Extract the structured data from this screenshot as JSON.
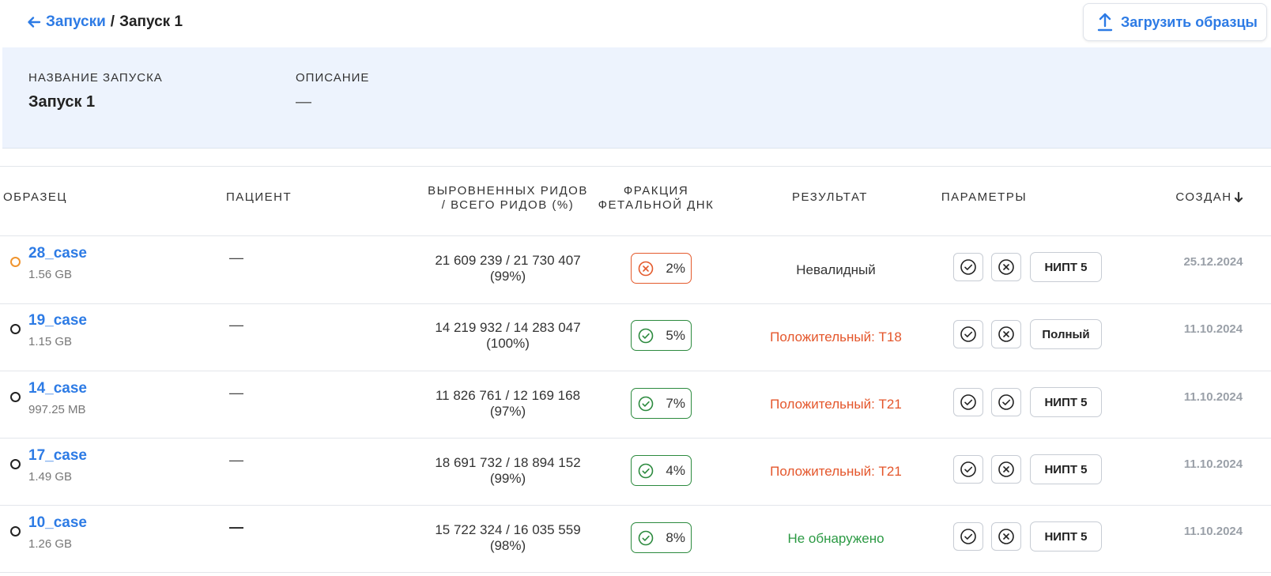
{
  "breadcrumb": {
    "parent": "Запуски",
    "separator": "/",
    "current": "Запуск 1"
  },
  "upload_button": "Загрузить образцы",
  "run_info": {
    "name_label": "НАЗВАНИЕ ЗАПУСКА",
    "name_value": "Запуск 1",
    "description_label": "ОПИСАНИЕ",
    "description_value": "—"
  },
  "table": {
    "headers": {
      "sample": "ОБРАЗЕЦ",
      "patient": "ПАЦИЕНТ",
      "reads_line1": "ВЫРОВНЕННЫХ РИДОВ",
      "reads_line2": "/ ВСЕГО РИДОВ (%)",
      "fraction_line1": "ФРАКЦИЯ",
      "fraction_line2": "ФЕТАЛЬНОЙ ДНК",
      "result": "РЕЗУЛЬТАТ",
      "params": "ПАРАМЕТРЫ",
      "created": "СОЗДАН"
    },
    "rows": [
      {
        "name": "28_case",
        "size": "1.56 GB",
        "patient": "—",
        "reads_line1": "21 609 239 / 21 730 407",
        "reads_line2": "(99%)",
        "fraction": "2%",
        "result": "Невалидный",
        "mode": "НИПТ 5",
        "created": "25.12.2024"
      },
      {
        "name": "19_case",
        "size": "1.15 GB",
        "patient": "—",
        "reads_line1": "14 219 932 / 14 283 047",
        "reads_line2": "(100%)",
        "fraction": "5%",
        "result": "Положительный: T18",
        "mode": "Полный",
        "created": "11.10.2024"
      },
      {
        "name": "14_case",
        "size": "997.25 MB",
        "patient": "—",
        "reads_line1": "11 826 761 / 12 169 168",
        "reads_line2": "(97%)",
        "fraction": "7%",
        "result": "Положительный: T21",
        "mode": "НИПТ 5",
        "created": "11.10.2024"
      },
      {
        "name": "17_case",
        "size": "1.49 GB",
        "patient": "—",
        "reads_line1": "18 691 732 / 18 894 152",
        "reads_line2": "(99%)",
        "fraction": "4%",
        "result": "Положительный: T21",
        "mode": "НИПТ 5",
        "created": "11.10.2024"
      },
      {
        "name": "10_case",
        "size": "1.26 GB",
        "patient": "—",
        "reads_line1": "15 722 324 / 16 035 559",
        "reads_line2": "(98%)",
        "fraction": "8%",
        "result": "Не обнаружено",
        "mode": "НИПТ 5",
        "created": "11.10.2024"
      }
    ]
  },
  "colors": {
    "accent": "#2d7be5",
    "positive_result": "#e4562b",
    "negative_result": "#2c9a44",
    "fraction_ok": "#2c8a3e",
    "fraction_bad": "#e45a2c",
    "status_pending": "#f0942e"
  },
  "icons": {
    "back": "arrow-left-icon",
    "upload": "upload-icon",
    "sort": "arrow-down-icon",
    "check": "check-circle-icon",
    "cross": "x-circle-icon"
  }
}
